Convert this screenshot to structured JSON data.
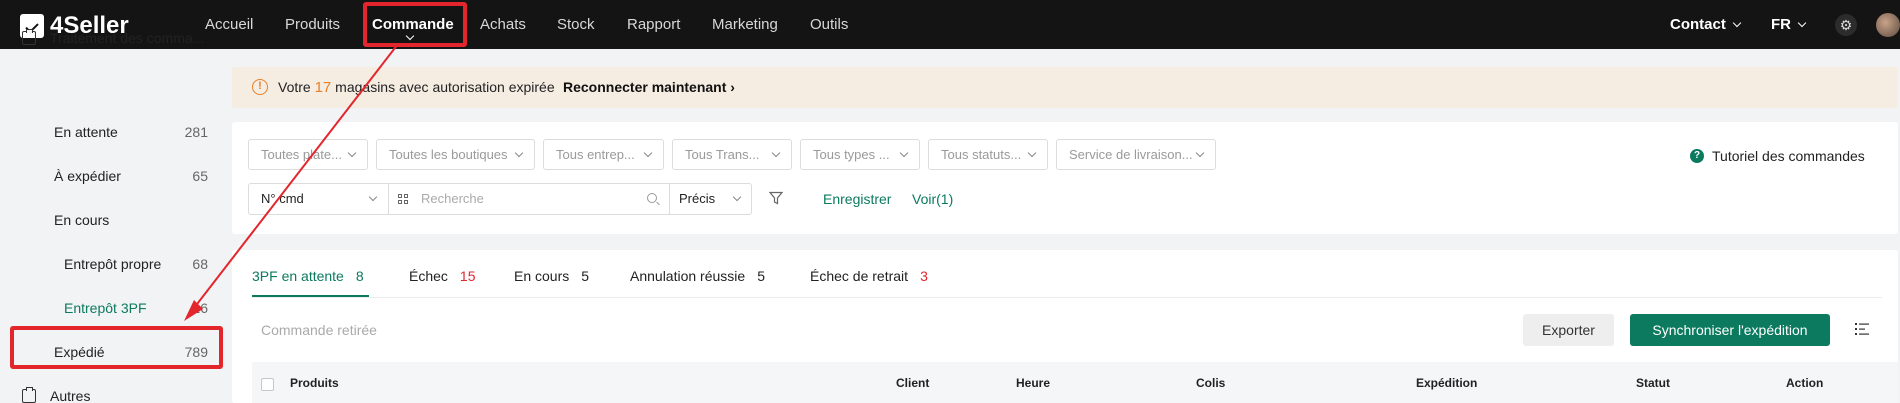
{
  "brand": {
    "name": "4Seller"
  },
  "nav": {
    "items": [
      "Accueil",
      "Produits",
      "Commande",
      "Achats",
      "Stock",
      "Rapport",
      "Marketing",
      "Outils"
    ],
    "active": "Commande",
    "contact": "Contact",
    "lang": "FR"
  },
  "sidebar": {
    "section_title": "Traitement des comma...",
    "items": [
      {
        "label": "En attente",
        "count": "281"
      },
      {
        "label": "À expédier",
        "count": "65"
      },
      {
        "label": "En cours",
        "count": ""
      },
      {
        "label": "Entrepôt propre",
        "count": "68"
      },
      {
        "label": "Entrepôt 3PF",
        "count": "16"
      },
      {
        "label": "Expédié",
        "count": "789"
      }
    ],
    "section2_title": "Autres"
  },
  "alert": {
    "prefix": "Votre",
    "count": "17",
    "suffix": "magasins avec autorisation expirée",
    "link": "Reconnecter maintenant"
  },
  "filters": {
    "dropdowns": [
      "Toutes plate...",
      "Toutes les boutiques",
      "Tous entrep...",
      "Tous Trans...",
      "Tous types ...",
      "Tous statuts...",
      "Service de livraison..."
    ],
    "tutorial": "Tutoriel des commandes",
    "search_field": "N° cmd",
    "search_placeholder": "Recherche",
    "match_mode": "Précis",
    "save_label": "Enregistrer",
    "view_label": "Voir(1)"
  },
  "tabs": [
    {
      "label": "3PF en attente",
      "count": "8"
    },
    {
      "label": "Échec",
      "count": "15"
    },
    {
      "label": "En cours",
      "count": "5"
    },
    {
      "label": "Annulation réussie",
      "count": "5"
    },
    {
      "label": "Échec de retrait",
      "count": "3"
    }
  ],
  "toolbar": {
    "withdrawn": "Commande retirée",
    "export_label": "Exporter",
    "sync_label": "Synchroniser l'expédition"
  },
  "table": {
    "columns": [
      "Produits",
      "Client",
      "Heure",
      "Colis",
      "Expédition",
      "Statut",
      "Action"
    ]
  },
  "colors": {
    "accent": "#0b7a5e",
    "annotation": "#e3262b",
    "warning": "#e8812a"
  }
}
